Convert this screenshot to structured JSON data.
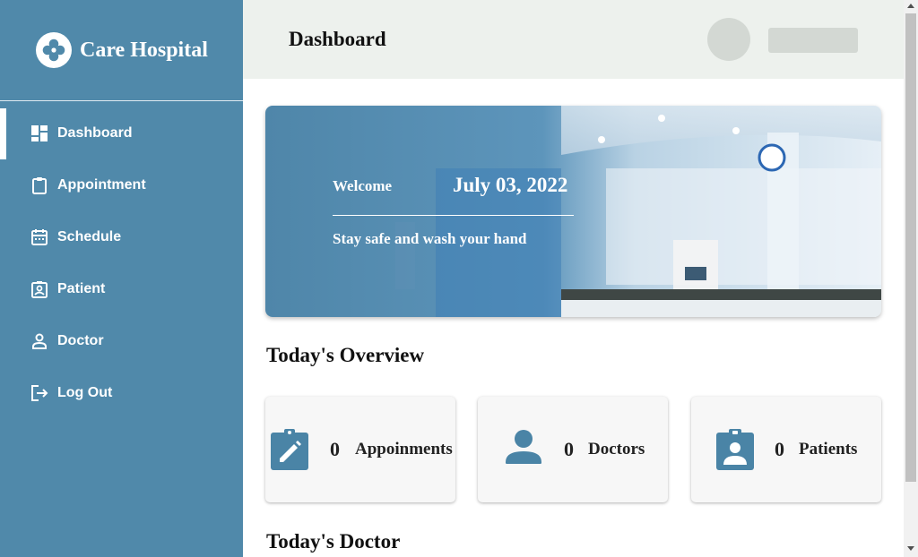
{
  "brand": {
    "name": "Care Hospital"
  },
  "sidebar": {
    "items": [
      {
        "label": "Dashboard",
        "icon": "dashboard-icon",
        "active": true
      },
      {
        "label": "Appointment",
        "icon": "clipboard-icon",
        "active": false
      },
      {
        "label": "Schedule",
        "icon": "calendar-icon",
        "active": false
      },
      {
        "label": "Patient",
        "icon": "patient-badge-icon",
        "active": false
      },
      {
        "label": "Doctor",
        "icon": "person-icon",
        "active": false
      },
      {
        "label": "Log Out",
        "icon": "logout-icon",
        "active": false
      }
    ]
  },
  "header": {
    "title": "Dashboard"
  },
  "banner": {
    "welcome": "Welcome",
    "date": "July 03, 2022",
    "tagline": "Stay safe and wash your hand"
  },
  "overview": {
    "title": "Today's Overview",
    "cards": [
      {
        "count": "0",
        "label": "Appoinments",
        "icon": "clipboard-edit-icon"
      },
      {
        "count": "0",
        "label": "Doctors",
        "icon": "person-icon"
      },
      {
        "count": "0",
        "label": "Patients",
        "icon": "patient-badge-icon"
      }
    ]
  },
  "doctors_section": {
    "title": "Today's Doctor"
  },
  "colors": {
    "sidebar": "#5089aa",
    "topbar": "#edf1ed",
    "accent": "#4a84a6",
    "card": "#f7f7f7"
  }
}
